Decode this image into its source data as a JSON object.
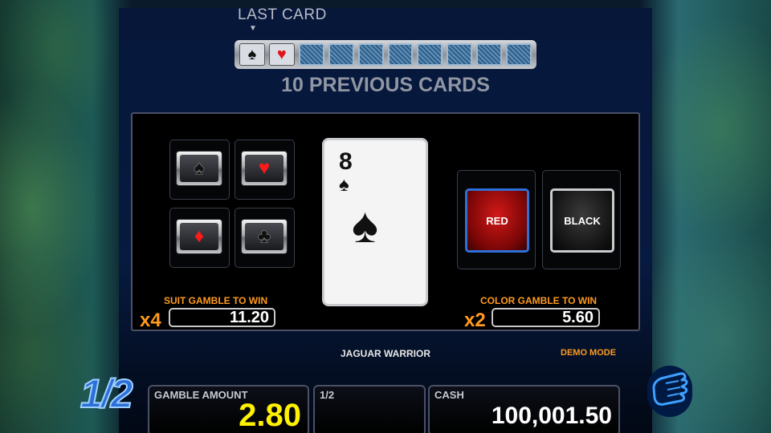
{
  "header": {
    "last_card_label": "LAST CARD",
    "last_card_arrow": "▼",
    "previous_cards_label": "10 PREVIOUS CARDS"
  },
  "history": [
    {
      "kind": "face",
      "suit": "♠",
      "color": "black"
    },
    {
      "kind": "face",
      "suit": "♥",
      "color": "red"
    },
    {
      "kind": "back"
    },
    {
      "kind": "back"
    },
    {
      "kind": "back"
    },
    {
      "kind": "back"
    },
    {
      "kind": "back"
    },
    {
      "kind": "back"
    },
    {
      "kind": "back"
    },
    {
      "kind": "back"
    }
  ],
  "suit_gamble": {
    "suits": [
      {
        "symbol": "♠",
        "color": "black",
        "name": "spade"
      },
      {
        "symbol": "♥",
        "color": "red",
        "name": "heart"
      },
      {
        "symbol": "♦",
        "color": "red",
        "name": "diamond"
      },
      {
        "symbol": "♣",
        "color": "black",
        "name": "club"
      }
    ],
    "label": "SUIT GAMBLE TO WIN",
    "multiplier": "x4",
    "value": "11.20"
  },
  "current_card": {
    "rank": "8",
    "suit": "♠"
  },
  "color_gamble": {
    "red_label": "RED",
    "black_label": "BLACK",
    "label": "COLOR GAMBLE TO WIN",
    "multiplier": "x2",
    "value": "5.60"
  },
  "footer": {
    "game_title": "JAGUAR WARRIOR",
    "demo_mode": "DEMO MODE",
    "gamble_step": "1/2",
    "gamble_amount_label": "GAMBLE AMOUNT",
    "gamble_amount_value": "2.80",
    "middle_label": "1/2",
    "cash_label": "CASH",
    "cash_value": "100,001.50"
  },
  "colors": {
    "accent_orange": "#ff9a1f",
    "gamble_yellow": "#fff200",
    "selected_blue": "#2f6fd8"
  }
}
